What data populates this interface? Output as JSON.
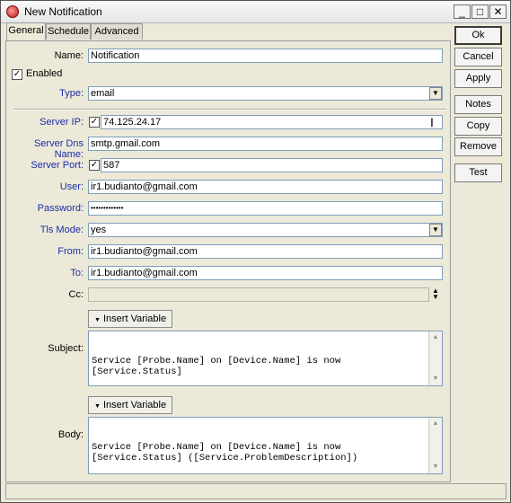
{
  "window": {
    "title": "New Notification",
    "controls": [
      "_",
      "□",
      "✕"
    ]
  },
  "tabs": [
    "General",
    "Schedule",
    "Advanced"
  ],
  "form": {
    "name": {
      "label": "Name:",
      "value": "Notification"
    },
    "enabled": {
      "label": "Enabled",
      "checked": true
    },
    "type": {
      "label": "Type:",
      "value": "email"
    },
    "server_ip": {
      "label": "Server IP:",
      "value": "74.125.24.17"
    },
    "server_dns": {
      "label": "Server Dns Name:",
      "value": "smtp.gmail.com"
    },
    "server_port": {
      "label": "Server Port:",
      "value": "587"
    },
    "user": {
      "label": "User:",
      "value": "ir1.budianto@gmail.com"
    },
    "password": {
      "label": "Password:",
      "value": "•••••••••••••"
    },
    "tls_mode": {
      "label": "Tls Mode:",
      "value": "yes"
    },
    "from": {
      "label": "From:",
      "value": "ir1.budianto@gmail.com"
    },
    "to": {
      "label": "To:",
      "value": "ir1.budianto@gmail.com"
    },
    "cc": {
      "label": "Cc:",
      "value": ""
    },
    "insert_variable": "Insert Variable",
    "subject": {
      "label": "Subject:",
      "value": "Service [Probe.Name] on [Device.Name] is now\n[Service.Status]"
    },
    "body": {
      "label": "Body:",
      "value": "Service [Probe.Name] on [Device.Name] is now\n[Service.Status] ([Service.ProblemDescription])"
    }
  },
  "buttons": {
    "ok": "Ok",
    "cancel": "Cancel",
    "apply": "Apply",
    "notes": "Notes",
    "copy": "Copy",
    "remove": "Remove",
    "test": "Test"
  },
  "colors": {
    "label_blue": "#1a2ea8",
    "window_bg": "#ece9d8"
  }
}
